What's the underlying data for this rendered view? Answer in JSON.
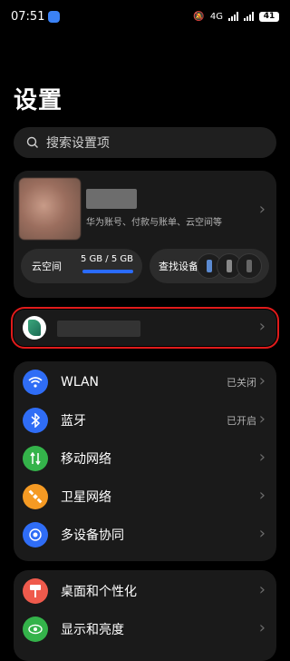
{
  "status": {
    "time": "07:51",
    "network": "4G",
    "battery": "41"
  },
  "page": {
    "title": "设置"
  },
  "search": {
    "placeholder": "搜索设置项"
  },
  "account": {
    "subtitle": "华为账号、付款与账单、云空间等",
    "cloud_label": "云空间",
    "cloud_usage": "5 GB / 5 GB",
    "cloud_usage_fraction": 1.0,
    "find_label": "查找设备"
  },
  "settings_group1": [
    {
      "label": "WLAN",
      "value": "已关闭",
      "icon": "wifi-icon",
      "color": "#2f6df6"
    },
    {
      "label": "蓝牙",
      "value": "已开启",
      "icon": "bluetooth-icon",
      "color": "#2f6df6"
    },
    {
      "label": "移动网络",
      "value": "",
      "icon": "mobile-network-icon",
      "color": "#34b34a"
    },
    {
      "label": "卫星网络",
      "value": "",
      "icon": "satellite-icon",
      "color": "#f59a23"
    },
    {
      "label": "多设备协同",
      "value": "",
      "icon": "multi-device-icon",
      "color": "#2f6df6"
    }
  ],
  "settings_group2": [
    {
      "label": "桌面和个性化",
      "value": "",
      "icon": "desktop-personalize-icon",
      "color": "#ef5a4c"
    },
    {
      "label": "显示和亮度",
      "value": "",
      "icon": "display-brightness-icon",
      "color": "#34b34a"
    }
  ]
}
